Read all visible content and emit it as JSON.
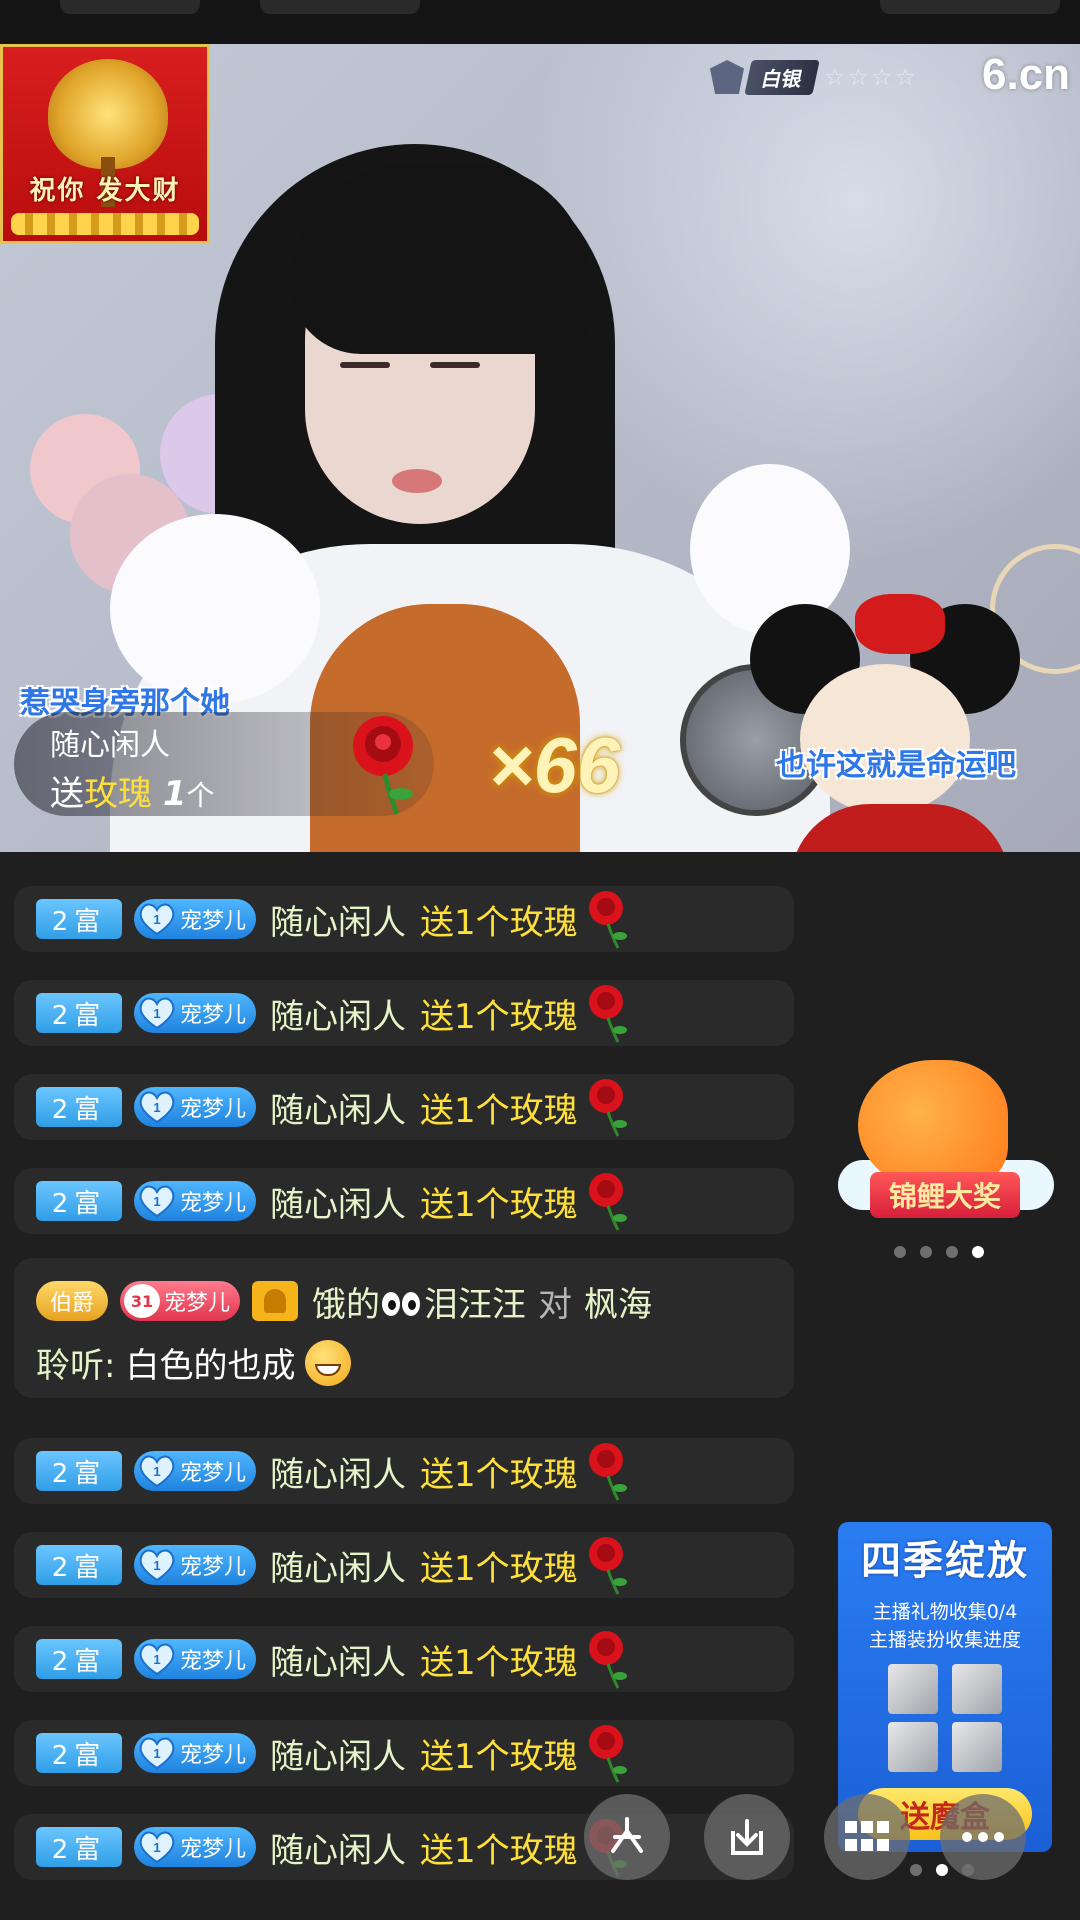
{
  "video": {
    "fortune_card_text": "祝你 发大财",
    "rank_label": "白银",
    "rank_stars": "☆☆☆☆",
    "logo": "6.cn",
    "lyric_left": "惹哭身旁那个她",
    "lyric_right": "也许这就是命运吧",
    "gift_banner": {
      "user": "随心闲人",
      "send_prefix": "送",
      "gift_name": "玫瑰",
      "count": "1",
      "unit": "个"
    },
    "combo": "×66"
  },
  "chat": {
    "gift_rows": [
      {
        "rich": "2富",
        "pet_level": "1",
        "pet": "宠梦儿",
        "user": "随心闲人",
        "gift": "送1个玫瑰"
      },
      {
        "rich": "2富",
        "pet_level": "1",
        "pet": "宠梦儿",
        "user": "随心闲人",
        "gift": "送1个玫瑰"
      },
      {
        "rich": "2富",
        "pet_level": "1",
        "pet": "宠梦儿",
        "user": "随心闲人",
        "gift": "送1个玫瑰"
      },
      {
        "rich": "2富",
        "pet_level": "1",
        "pet": "宠梦儿",
        "user": "随心闲人",
        "gift": "送1个玫瑰"
      },
      {
        "rich": "2富",
        "pet_level": "1",
        "pet": "宠梦儿",
        "user": "随心闲人",
        "gift": "送1个玫瑰"
      },
      {
        "rich": "2富",
        "pet_level": "1",
        "pet": "宠梦儿",
        "user": "随心闲人",
        "gift": "送1个玫瑰"
      },
      {
        "rich": "2富",
        "pet_level": "1",
        "pet": "宠梦儿",
        "user": "随心闲人",
        "gift": "送1个玫瑰"
      },
      {
        "rich": "2富",
        "pet_level": "1",
        "pet": "宠梦儿",
        "user": "随心闲人",
        "gift": "送1个玫瑰"
      },
      {
        "rich": "2富",
        "pet_level": "1",
        "pet": "宠梦儿",
        "user": "随心闲人",
        "gift": "送1个玫瑰"
      }
    ],
    "message": {
      "noble": "伯爵",
      "pet_level": "31",
      "pet": "宠梦儿",
      "user_prefix": "饿的",
      "user_suffix": "泪汪汪",
      "to": "对",
      "target": "枫海",
      "label": "聆听:",
      "text": "白色的也成"
    }
  },
  "widgets": {
    "koi_title": "锦鲤大奖",
    "season": {
      "title": "四季绽放",
      "line1": "主播礼物收集0/4",
      "line2": "主播装扮收集进度",
      "button": "送魔盒"
    }
  },
  "colors": {
    "gift_text": "#ffe03a",
    "user_text": "#e6f2c8",
    "rich_badge": "#2f9ee6"
  }
}
